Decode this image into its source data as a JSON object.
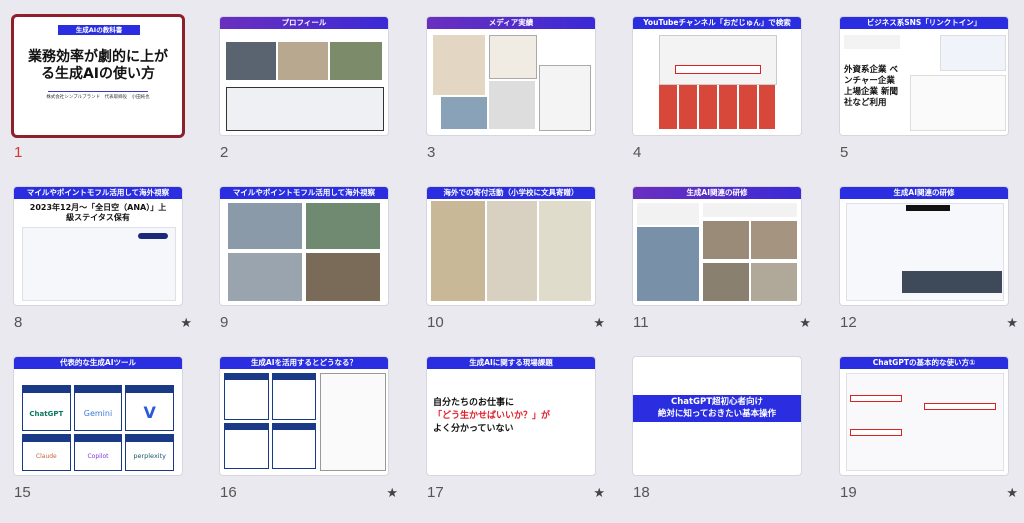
{
  "slides": [
    {
      "number": "1",
      "title_bar": "生成AIの教科書",
      "headline": "業務効率が劇的に上がる生成AIの使い方",
      "sub": "株式会社シンプルブランド　代表取締役　小田純也",
      "starred": false
    },
    {
      "number": "2",
      "title_bar": "プロフィール",
      "starred": false
    },
    {
      "number": "3",
      "title_bar": "メディア実績",
      "starred": false
    },
    {
      "number": "4",
      "title_bar": "YouTubeチャンネル「おだじゅん」で検索",
      "starred": false
    },
    {
      "number": "5",
      "title_bar": "ビジネス系SNS「リンクトイン」",
      "body": "外資系企業 ベンチャー企業 上場企業 新聞社など利用",
      "starred": false
    },
    {
      "number": "8",
      "title_bar": "マイルやポイントモフル活用して海外視察",
      "body": "2023年12月～「全日空（ANA）」上級ステイタス保有",
      "starred": true
    },
    {
      "number": "9",
      "title_bar": "マイルやポイントモフル活用して海外視察",
      "starred": false
    },
    {
      "number": "10",
      "title_bar": "海外での寄付活動（小学校に文具寄贈）",
      "starred": true
    },
    {
      "number": "11",
      "title_bar": "生成AI関連の研修",
      "starred": true
    },
    {
      "number": "12",
      "title_bar": "生成AI関連の研修",
      "starred": true
    },
    {
      "number": "15",
      "title_bar": "代表的な生成AIツール",
      "tools": [
        "ChatGPT",
        "Gemini",
        "V",
        "Claude",
        "Copilot",
        "perplexity"
      ],
      "starred": false
    },
    {
      "number": "16",
      "title_bar": "生成AIを活用するとどうなる？",
      "starred": true
    },
    {
      "number": "17",
      "title_bar": "生成AIに関する現場課題",
      "body1": "自分たちのお仕事に",
      "body2": "「どう生かせばいいか？」が",
      "body3": "よく分かっていない",
      "starred": true
    },
    {
      "number": "18",
      "title_bar": "",
      "body1": "ChatGPT超初心者向け",
      "body2": "絶対に知っておきたい基本操作",
      "starred": false
    },
    {
      "number": "19",
      "title_bar": "ChatGPTの基本的な使い方①",
      "starred": true
    }
  ],
  "star_glyph": "★"
}
